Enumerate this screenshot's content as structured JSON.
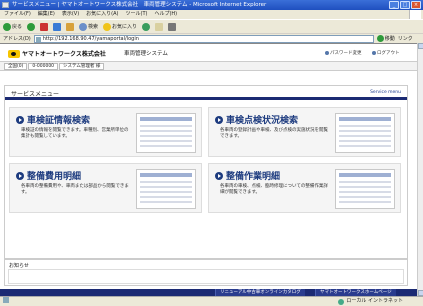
{
  "window": {
    "title": "サービスメニュー | ヤマトオートワークス株式会社　車両管理システム - Microsoft Internet Explorer",
    "buttons": [
      "_",
      "□",
      "×"
    ]
  },
  "menubar": [
    "ファイル(F)",
    "編集(E)",
    "表示(V)",
    "お気に入り(A)",
    "ツール(T)",
    "ヘルプ(H)"
  ],
  "toolbar": {
    "back": "戻る",
    "search": "検索",
    "favorites": "お気に入り"
  },
  "address": {
    "label": "アドレス(D)",
    "url": "http://192.168.90.47/yamaportal/login",
    "go": "移動",
    "links": "リンク"
  },
  "header": {
    "logo_text": "ヤマトオートワークス株式会社",
    "system_name": "車両管理システム",
    "password_link": "パスワード変更",
    "logout_link": "ログアウト"
  },
  "userbar": [
    "全国(0)",
    "0-000000",
    "システム管理者 様"
  ],
  "menu": {
    "title": "サービスメニュー",
    "subtitle": "Service menu",
    "cards": [
      {
        "title": "車検証情報検索",
        "desc": "車検証の情報を閲覧できます。車種別、営業所単位の集計も閲覧しています。"
      },
      {
        "title": "車検点検状況検索",
        "desc": "各車両の登録計画や車検、及び点検の実施状況を閲覧できます。"
      },
      {
        "title": "整備費用明細",
        "desc": "各車両の整備費用や、車両または部品から閲覧できます。"
      },
      {
        "title": "整備作業明細",
        "desc": "各車両の車検、点検、臨時修理についての整備作業詳細が閲覧できます。"
      }
    ]
  },
  "notice": {
    "title": "お知らせ"
  },
  "footer": {
    "link1": "リニューアル中古車オンラインカタログ",
    "link2": "ヤマトオートワークスホームページ"
  },
  "status": {
    "left": "",
    "zone": "ローカル イントラネット"
  }
}
